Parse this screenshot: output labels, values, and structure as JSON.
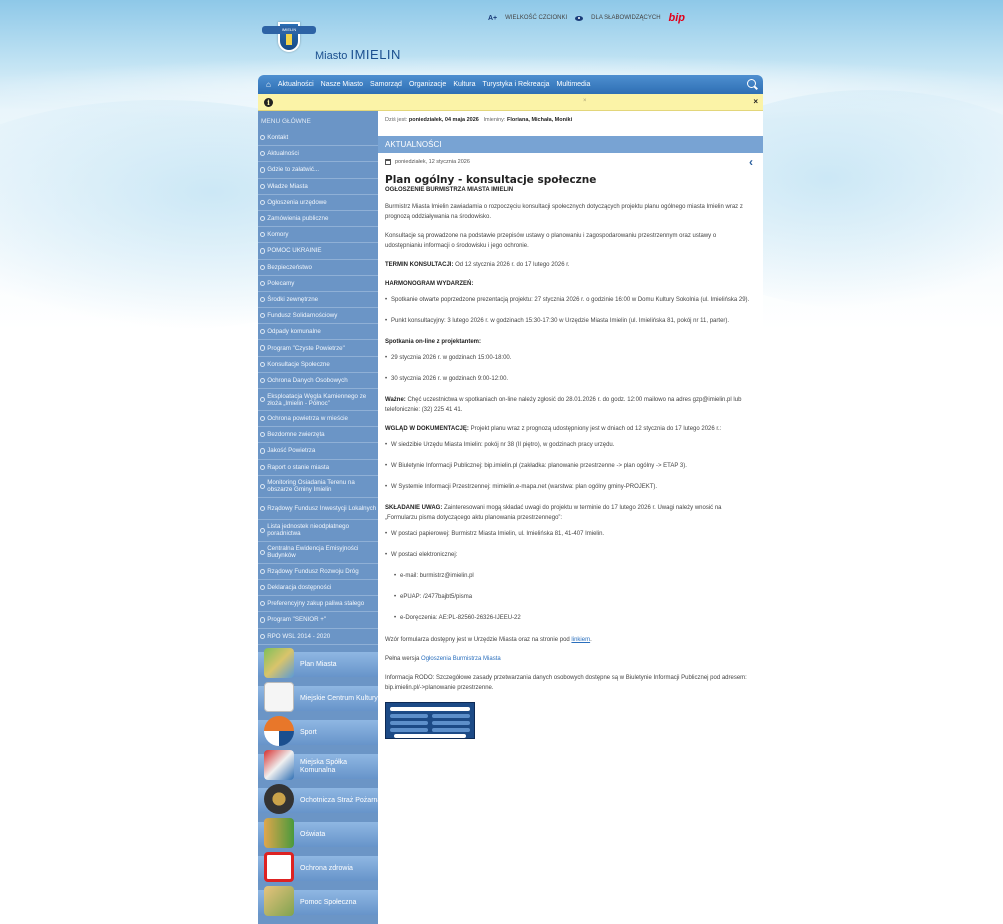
{
  "header": {
    "font_size_label": "WIELKOŚĆ CZCIONKI",
    "font_size_icon": "A+",
    "low_vision_label": "DLA SŁABOWIDZĄCYCH",
    "bip_label": "bip",
    "site_prefix": "Miasto",
    "site_name": "IMIELIN",
    "crest_banner": "IMIELIN"
  },
  "nav": {
    "items": [
      "Aktualności",
      "Nasze Miasto",
      "Samorząd",
      "Organizacje",
      "Kultura",
      "Turystyka i Rekreacja",
      "Multimedia"
    ]
  },
  "alert": {
    "close_small": "×",
    "close": "×",
    "info_icon": "i"
  },
  "sidebar": {
    "heading": "MENU GŁÓWNE",
    "items": [
      "Kontakt",
      "Aktualności",
      "Gdzie to załatwić...",
      "Władze Miasta",
      "Ogłoszenia urzędowe",
      "Zamówienia publiczne",
      "Komory",
      "POMOC UKRAINIE",
      "Bezpieczeństwo",
      "Polecamy",
      "Środki zewnętrzne",
      "Fundusz Solidarnościowy",
      "Odpady komunalne",
      "Program \"Czyste Powietrze\"",
      "Konsultacje Społeczne",
      "Ochrona Danych Osobowych",
      "Eksploatacja Węgla Kamiennego ze złoża „Imielin - Północ”",
      "Ochrona powietrza w mieście",
      "Bezdomne zwierzęta",
      "Jakość Powietrza",
      "Raport o stanie miasta",
      "Monitoring Osiadania Terenu na obszarze Gminy Imielin",
      "Rządowy Fundusz Inwestycji Lokalnych",
      "Lista jednostek nieodpłatnego poradnictwa",
      "Centralna Ewidencja Emisyjności Budynków",
      "Rządowy Fundusz Rozwoju Dróg",
      "Deklaracja dostępności",
      "Preferencyjny zakup paliwa stałego",
      "Program \"SENIOR +\"",
      "RPO WSL 2014 - 2020"
    ],
    "tiles": [
      "Plan Miasta",
      "Miejskie Centrum Kultury",
      "Sport",
      "Miejska Spółka Komunalna",
      "Ochotnicza Straż Pożarna",
      "Oświata",
      "Ochrona zdrowia",
      "Pomoc Społeczna"
    ]
  },
  "today": {
    "prefix": "Dziś jest:",
    "date": "poniedziałek, 04 maja 2026",
    "names_prefix": "Imieniny:",
    "names": "Floriana, Michała, Moniki"
  },
  "section_title": "AKTUALNOŚCI",
  "article": {
    "date": "poniedziałek, 12 stycznia 2026",
    "title": "Plan ogólny - konsultacje społeczne",
    "subtitle": "OGŁOSZENIE BURMISTRZA MIASTA IMIELIN",
    "p1": "Burmistrz Miasta Imielin zawiadamia o rozpoczęciu konsultacji społecznych dotyczących projektu planu ogólnego miasta Imielin wraz z prognozą oddziaływania na środowisko.",
    "p2": "Konsultacje są prowadzone na podstawie przepisów ustawy o planowaniu i zagospodarowaniu przestrzennym oraz ustawy o udostępnianiu informacji o środowisku i jego ochronie.",
    "term_label": "TERMIN KONSULTACJI:",
    "term_text": "Od 12 stycznia 2026 r. do 17 lutego 2026 r.",
    "harm_label": "HARMONOGRAM WYDARZEŃ:",
    "harm_items": [
      "Spotkanie otwarte poprzedzone prezentacją projektu: 27 stycznia 2026 r. o godzinie 16:00 w Domu Kultury Sokolnia (ul. Imielińska 29).",
      "Punkt konsultacyjny: 3 lutego 2026 r. w godzinach 15:30-17:30 w Urzędzie Miasta Imielin (ul. Imielińska 81, pokój nr 11, parter)."
    ],
    "online_label": "Spotkania on-line z projektantem:",
    "online_items": [
      "29 stycznia 2026 r. w godzinach 15:00-18:00.",
      "30 stycznia 2026 r. w godzinach 9:00-12:00."
    ],
    "important_label": "Ważne:",
    "important_text": "Chęć uczestnictwa w spotkaniach on-line należy zgłosić do 28.01.2026 r. do godz. 12:00 mailowo na adres gzp@imielin.pl lub telefonicznie: (32) 225 41 41.",
    "docs_label": "WGLĄD W DOKUMENTACJĘ:",
    "docs_text": "Projekt planu wraz z prognozą udostępniony jest w dniach od 12 stycznia do 17 lutego 2026 r.:",
    "docs_items": [
      "W siedzibie Urzędu Miasta Imielin: pokój nr 38 (II piętro), w godzinach pracy urzędu.",
      "W Biuletynie Informacji Publicznej: bip.imielin.pl (zakładka: planowanie przestrzenne -> plan ogólny -> ETAP 3).",
      "W Systemie Informacji Przestrzennej: mimielin.e-mapa.net (warstwa: plan ogólny gminy-PROJEKT)."
    ],
    "remarks_label": "SKŁADANIE UWAG:",
    "remarks_text": "Zainteresowani mogą składać uwagi do projektu w terminie do 17 lutego 2026 r. Uwagi należy wnosić na „Formularzu pisma dotyczącego aktu planowania przestrzennego”:",
    "remarks_items": [
      "W postaci papierowej: Burmistrz Miasta Imielin, ul. Imielińska 81, 41-407 Imielin.",
      "W postaci elektronicznej:"
    ],
    "electronic_items": [
      "e-mail: burmistrz@imielin.pl",
      "ePUAP: /2477bajbt5/pisma",
      "e-Doręczenia: AE:PL-82560-26326-IJEEU-22"
    ],
    "form_text": "Wzór formularza dostępny jest w Urzędzie Miasta oraz na stronie pod",
    "form_link": "linkiem",
    "full_text": "Pełna wersja",
    "full_link": "Ogłoszenia Burmistrza Miasta",
    "rodo_text": "Informacja RODO: Szczegółowe zasady przetwarzania danych osobowych dostępne są w Biuletynie Informacji Publicznej pod adresem: bip.imielin.pl/->planowanie przestrzenne."
  },
  "colors": {
    "nav": "#3a7cc2",
    "sidebar": "#6b95c6",
    "alert": "#fbf3a7",
    "bip": "#e1001a",
    "brand": "#1b4f8f"
  }
}
